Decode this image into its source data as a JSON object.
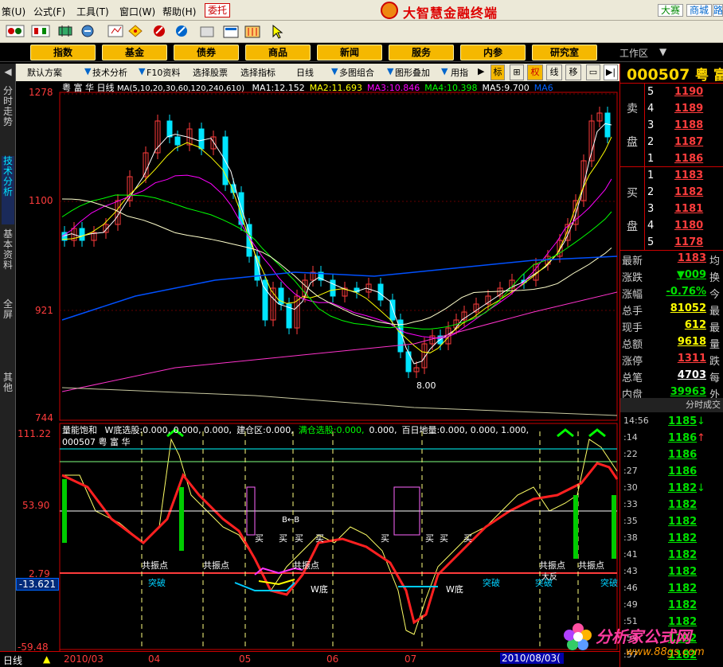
{
  "menu": {
    "items": [
      "策(U)",
      "公式(F)",
      "工具(T)",
      "窗口(W)",
      "帮助(H)"
    ],
    "entrust": "委托",
    "app_title": "大智慧金融终端",
    "links": [
      "大赛",
      "商城",
      "路"
    ]
  },
  "nav": {
    "buttons": [
      "指数",
      "基金",
      "债券",
      "商品",
      "新闻",
      "服务",
      "内参",
      "研究室"
    ],
    "workspace": "工作区"
  },
  "subtoolbar": {
    "items": [
      "默认方案",
      "技术分析",
      "F10资料",
      "选择股票",
      "选择指标",
      "日线",
      "多图组合",
      "图形叠加",
      "用指"
    ],
    "tabs": [
      "标",
      "权",
      "线",
      "移"
    ]
  },
  "left_tabs": [
    "分时走势",
    "技术分析",
    "基本资料",
    "全屏",
    "其他"
  ],
  "chart": {
    "stock_name": "粤 富 华",
    "period": "日线",
    "ma_title": "MA(5,10,20,30,60,120,240,610)",
    "ma_values": [
      {
        "label": "MA1:",
        "value": "12.152",
        "color": "#ffffff"
      },
      {
        "label": "MA2:",
        "value": "11.693",
        "color": "#ffff00"
      },
      {
        "label": "MA3:",
        "value": "10.846",
        "color": "#ff00ff"
      },
      {
        "label": "MA4:",
        "value": "10.398",
        "color": "#00ff00"
      },
      {
        "label": "MA5:",
        "value": "9.700",
        "color": "#ffffff"
      },
      {
        "label": "MA6",
        "value": "",
        "color": "#0060ff"
      }
    ],
    "price_ticks": [
      "1278",
      "1100",
      "921",
      "744"
    ],
    "low_label": "8.00",
    "indicator_title": "量能饱和",
    "indicator_params": [
      {
        "label": "W底选股:",
        "value": "0.000, 0.000, 0.000,",
        "color": "#ffffff"
      },
      {
        "label": "建仓区:",
        "value": "0.000,",
        "color": "#ffffff"
      },
      {
        "label": "满仓选股:",
        "value": "0.000,",
        "color": "#00ff00"
      },
      {
        "label": "",
        "value": "0.000,",
        "color": "#ffffff"
      },
      {
        "label": "百日地量:",
        "value": "0.000, 0.000, 1.000,",
        "color": "#ffffff"
      }
    ],
    "indicator_code": "000507 粤 富 华",
    "ind_ticks": [
      "111.22",
      "53.90",
      "2.79",
      "-59.48"
    ],
    "cursor_value": "-13.621",
    "annotations": {
      "gongzhen": "共振点",
      "tupo": "突破",
      "wdi": "W底",
      "mai": "买",
      "b_arrow": "B←B",
      "dafan": "大反"
    },
    "dates": [
      "2010/03",
      "04",
      "05",
      "06",
      "07",
      "2010/08/03("
    ]
  },
  "status": {
    "label": "日线"
  },
  "quote": {
    "code": "000507",
    "name_part": "粤 富",
    "sell_label": [
      "卖",
      "盘"
    ],
    "buy_label": [
      "买",
      "盘"
    ],
    "sell": [
      {
        "level": "5",
        "price": "1190"
      },
      {
        "level": "4",
        "price": "1189"
      },
      {
        "level": "3",
        "price": "1188"
      },
      {
        "level": "2",
        "price": "1187"
      },
      {
        "level": "1",
        "price": "1186"
      }
    ],
    "buy": [
      {
        "level": "1",
        "price": "1183"
      },
      {
        "level": "2",
        "price": "1182"
      },
      {
        "level": "3",
        "price": "1181"
      },
      {
        "level": "4",
        "price": "1180"
      },
      {
        "level": "5",
        "price": "1178"
      }
    ],
    "stats": [
      {
        "label": "最新",
        "value": "1183",
        "vcolor": "#ff3c3c",
        "right": "均"
      },
      {
        "label": "涨跌",
        "value": "▼009",
        "vcolor": "#00e000",
        "right": "换"
      },
      {
        "label": "涨幅",
        "value": "-0.76%",
        "vcolor": "#00e000",
        "right": "今"
      },
      {
        "label": "总手",
        "value": "81052",
        "vcolor": "#ffff00",
        "right": "最"
      },
      {
        "label": "现手",
        "value": "612",
        "vcolor": "#ffff00",
        "right": "最"
      },
      {
        "label": "总额",
        "value": "9618",
        "vcolor": "#ffff00",
        "right": "量"
      },
      {
        "label": "涨停",
        "value": "1311",
        "vcolor": "#ff3c3c",
        "right": "跌"
      },
      {
        "label": "总笔",
        "value": "4703",
        "vcolor": "#ffffff",
        "right": "每"
      },
      {
        "label": "内盘",
        "value": "39963",
        "vcolor": "#00e000",
        "right": "外"
      }
    ],
    "ticks_title": "分时成交",
    "ticks": [
      {
        "time": "14:56",
        "price": "1185",
        "dir": "down"
      },
      {
        "time": ":14",
        "price": "1186",
        "dir": "up"
      },
      {
        "time": ":22",
        "price": "1186",
        "dir": ""
      },
      {
        "time": ":27",
        "price": "1186",
        "dir": ""
      },
      {
        "time": ":30",
        "price": "1182",
        "dir": "down"
      },
      {
        "time": ":33",
        "price": "1182",
        "dir": ""
      },
      {
        "time": ":35",
        "price": "1182",
        "dir": ""
      },
      {
        "time": ":38",
        "price": "1182",
        "dir": ""
      },
      {
        "time": ":41",
        "price": "1182",
        "dir": ""
      },
      {
        "time": ":43",
        "price": "1182",
        "dir": ""
      },
      {
        "time": ":46",
        "price": "1182",
        "dir": ""
      },
      {
        "time": ":49",
        "price": "1182",
        "dir": ""
      },
      {
        "time": ":51",
        "price": "1182",
        "dir": ""
      },
      {
        "time": ":54",
        "price": "1182",
        "dir": ""
      },
      {
        "time": ":57",
        "price": "1182",
        "dir": ""
      }
    ]
  },
  "watermark": {
    "text": "分析家公式网",
    "url": "www.88gs.com"
  }
}
